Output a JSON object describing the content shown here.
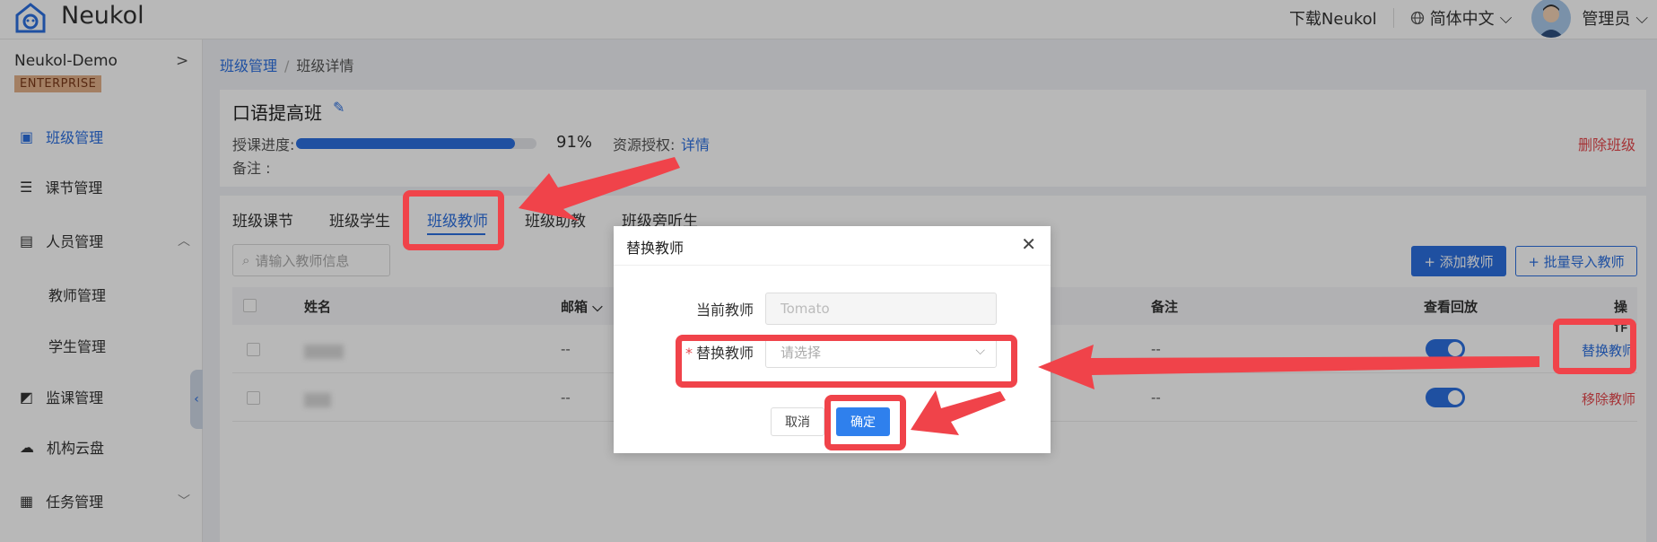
{
  "header": {
    "brand": "Neukol",
    "download": "下载Neukol",
    "language": "简体中文",
    "user": "管理员"
  },
  "sidebar": {
    "org": "Neukol-Demo",
    "edition": "ENTERPRISE",
    "items": [
      {
        "label": "班级管理",
        "icon": "class-icon",
        "active": true
      },
      {
        "label": "课节管理",
        "icon": "lesson-icon"
      },
      {
        "label": "人员管理",
        "icon": "people-icon",
        "expanded": true
      },
      {
        "label": "教师管理",
        "sub": true
      },
      {
        "label": "学生管理",
        "sub": true
      },
      {
        "label": "监课管理",
        "icon": "monitor-icon"
      },
      {
        "label": "机构云盘",
        "icon": "cloud-icon"
      },
      {
        "label": "任务管理",
        "icon": "task-icon"
      }
    ]
  },
  "breadcrumb": {
    "parent": "班级管理",
    "separator": "/",
    "current": "班级详情"
  },
  "class_info": {
    "title": "口语提高班",
    "progress_label": "授课进度:",
    "progress_value": "91%",
    "progress_fraction": 0.91,
    "resource_label": "资源授权:",
    "resource_link": "详情",
    "note_label": "备注 :",
    "delete": "删除班级"
  },
  "tabs": [
    "班级课节",
    "班级学生",
    "班级教师",
    "班级助教",
    "班级旁听生"
  ],
  "active_tab": 2,
  "search": {
    "placeholder": "请输入教师信息"
  },
  "toolbar": {
    "add": "+ 添加教师",
    "import": "+ 批量导入教师"
  },
  "table": {
    "headers": {
      "name": "姓名",
      "email": "邮箱",
      "note": "备注",
      "playback": "查看回放",
      "action": "操作"
    },
    "rows": [
      {
        "email": "--",
        "note": "--",
        "action": "替换教师"
      },
      {
        "email": "--",
        "note": "--",
        "action": "移除教师"
      }
    ]
  },
  "modal": {
    "title": "替换教师",
    "current_label": "当前教师",
    "current_value": "Tomato",
    "replace_label": "替换教师",
    "replace_placeholder": "请选择",
    "cancel": "取消",
    "ok": "确定"
  },
  "colors": {
    "primary": "#2b6fe0",
    "danger": "#e5484d",
    "highlight": "#f0434a"
  }
}
